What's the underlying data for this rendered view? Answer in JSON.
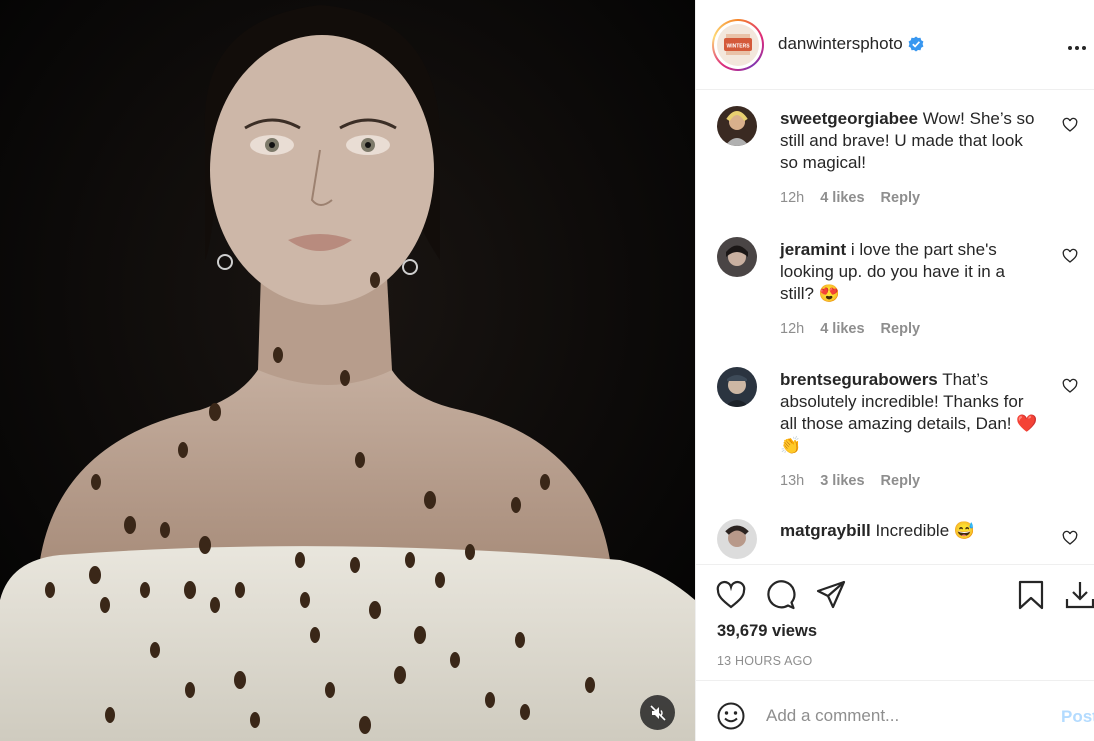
{
  "post": {
    "username": "danwintersphoto",
    "verified": true,
    "avatar_text": "WINTERS",
    "views": "39,679 views",
    "time_ago": "13 HOURS AGO"
  },
  "comments": [
    {
      "user": "sweetgeorgiabee",
      "text": "Wow! She’s so still and brave! U made that look so magical!",
      "time": "12h",
      "likes": "4 likes",
      "reply": "Reply"
    },
    {
      "user": "jeramint",
      "text": "i love the part she's looking up. do you have it in a still? 😍",
      "time": "12h",
      "likes": "4 likes",
      "reply": "Reply"
    },
    {
      "user": "brentsegurabowers",
      "text": "That’s absolutely incredible! Thanks for all those amazing details, Dan! ❤️ 👏",
      "time": "13h",
      "likes": "3 likes",
      "reply": "Reply"
    },
    {
      "user": "matgraybill",
      "text": "Incredible 😅"
    }
  ],
  "add_comment": {
    "placeholder": "Add a comment...",
    "post_label": "Post"
  },
  "icons": {
    "verified": "verified-badge-icon",
    "more": "more-options-icon",
    "like": "heart-icon",
    "comment": "comment-bubble-icon",
    "share": "paper-plane-icon",
    "save": "bookmark-icon",
    "download": "download-icon",
    "emoji": "emoji-face-icon",
    "mute": "speaker-muted-icon"
  },
  "colors": {
    "verified_blue": "#3897f0",
    "post_disabled": "#b3dbff",
    "muted_text": "#8e8e8e"
  }
}
